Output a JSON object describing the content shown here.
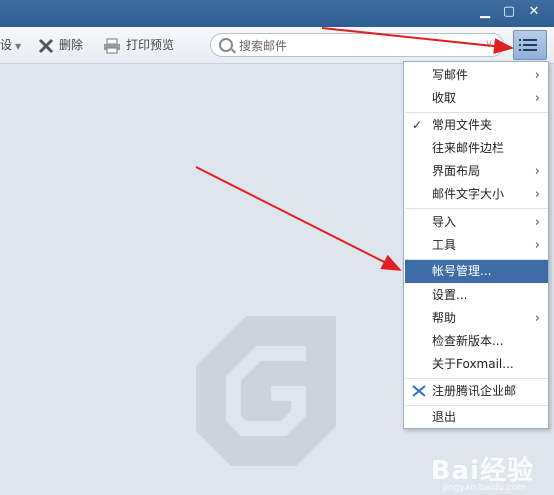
{
  "toolbar": {
    "cut_label": "设",
    "delete_label": "删除",
    "print_label": "打印预览",
    "cut_icon": "scissors-icon",
    "delete_icon": "delete-icon",
    "print_icon": "printer-icon"
  },
  "search": {
    "placeholder": "搜索邮件"
  },
  "window": {
    "minimize": "▁",
    "maximize": "▢",
    "close": "✕"
  },
  "menu": {
    "items": [
      {
        "label": "写邮件",
        "submenu": true
      },
      {
        "label": "收取",
        "submenu": true
      },
      {
        "label": "常用文件夹",
        "checked": true
      },
      {
        "label": "往来邮件边栏"
      },
      {
        "label": "界面布局",
        "submenu": true
      },
      {
        "label": "邮件文字大小",
        "submenu": true
      },
      {
        "label": "导入",
        "submenu": true
      },
      {
        "label": "工具",
        "submenu": true
      },
      {
        "label": "帐号管理...",
        "highlighted": true
      },
      {
        "label": "设置..."
      },
      {
        "label": "帮助",
        "submenu": true
      },
      {
        "label": "检查新版本..."
      },
      {
        "label": "关于Foxmail..."
      },
      {
        "label": "注册腾讯企业邮",
        "icon": "tencent-exmail-icon"
      },
      {
        "label": "退出"
      }
    ]
  },
  "watermark": {
    "text": "Bai经验",
    "sub": "jingyan.baidu.com"
  },
  "colors": {
    "titlebar": "#3f6da2",
    "highlight": "#3d6ca8",
    "arrow": "#e02020"
  }
}
